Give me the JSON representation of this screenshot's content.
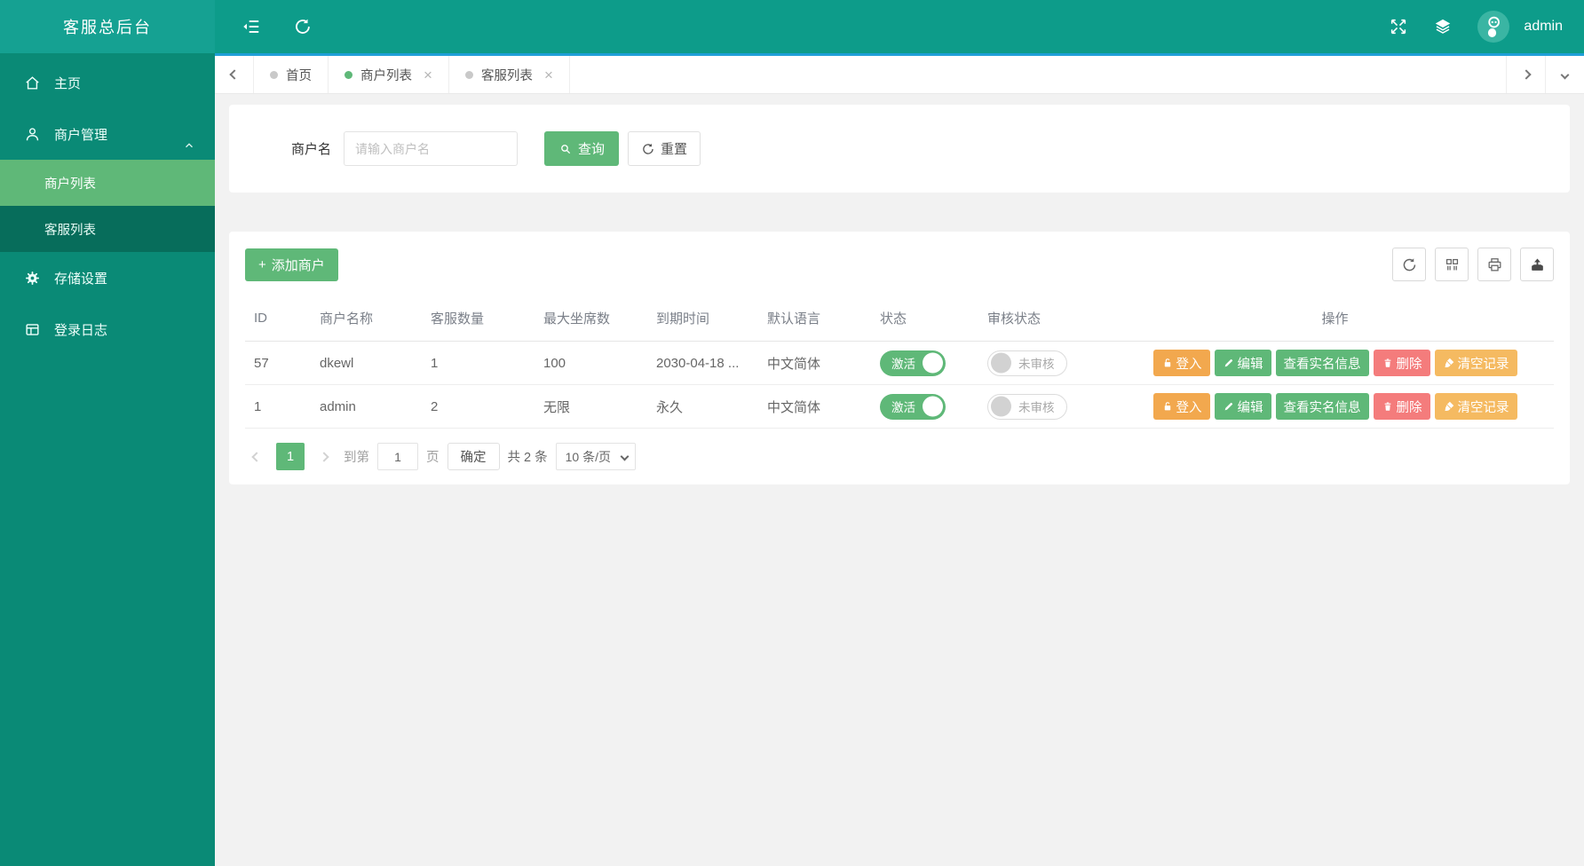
{
  "app": {
    "title": "客服总后台",
    "user": "admin"
  },
  "colors": {
    "accent_green": "#5FB878",
    "teal_header": "#0d9c8a",
    "sidebar_bg": "#0a8a76",
    "orange": "#f2a84e",
    "orange_light": "#f5ba61",
    "red": "#f47c7c",
    "progress_blue": "#1f9fd8"
  },
  "sidebar": {
    "items": [
      {
        "label": "主页",
        "icon": "home-icon"
      },
      {
        "label": "商户管理",
        "icon": "user-icon",
        "expanded": true,
        "children": [
          {
            "label": "商户列表",
            "active": true
          },
          {
            "label": "客服列表",
            "active": false
          }
        ]
      },
      {
        "label": "存储设置",
        "icon": "gear-icon"
      },
      {
        "label": "登录日志",
        "icon": "log-icon"
      }
    ]
  },
  "tabs": [
    {
      "label": "首页",
      "active": false,
      "closable": false
    },
    {
      "label": "商户列表",
      "active": true,
      "closable": true
    },
    {
      "label": "客服列表",
      "active": false,
      "closable": true
    }
  ],
  "search": {
    "label": "商户名",
    "placeholder": "请输入商户名",
    "query_label": "查询",
    "reset_label": "重置"
  },
  "toolbar": {
    "add_label": "添加商户",
    "icons": [
      "refresh-icon",
      "filter-columns-icon",
      "print-icon",
      "export-icon"
    ]
  },
  "table": {
    "headers": [
      "ID",
      "商户名称",
      "客服数量",
      "最大坐席数",
      "到期时间",
      "默认语言",
      "状态",
      "审核状态",
      "操作"
    ],
    "actions": {
      "login": "登入",
      "edit": "编辑",
      "view": "查看实名信息",
      "delete": "删除",
      "clear": "清空记录"
    },
    "rows": [
      {
        "id": "57",
        "name": "dkewl",
        "agents": "1",
        "seats": "100",
        "expire": "2030-04-18 ...",
        "lang": "中文简体",
        "status": "激活",
        "audit": "未审核"
      },
      {
        "id": "1",
        "name": "admin",
        "agents": "2",
        "seats": "无限",
        "expire": "永久",
        "lang": "中文简体",
        "status": "激活",
        "audit": "未审核"
      }
    ]
  },
  "pagination": {
    "page": "1",
    "goto_prefix": "到第",
    "goto_value": "1",
    "goto_suffix": "页",
    "confirm_label": "确定",
    "total_label": "共 2 条",
    "per_page": "10 条/页"
  }
}
